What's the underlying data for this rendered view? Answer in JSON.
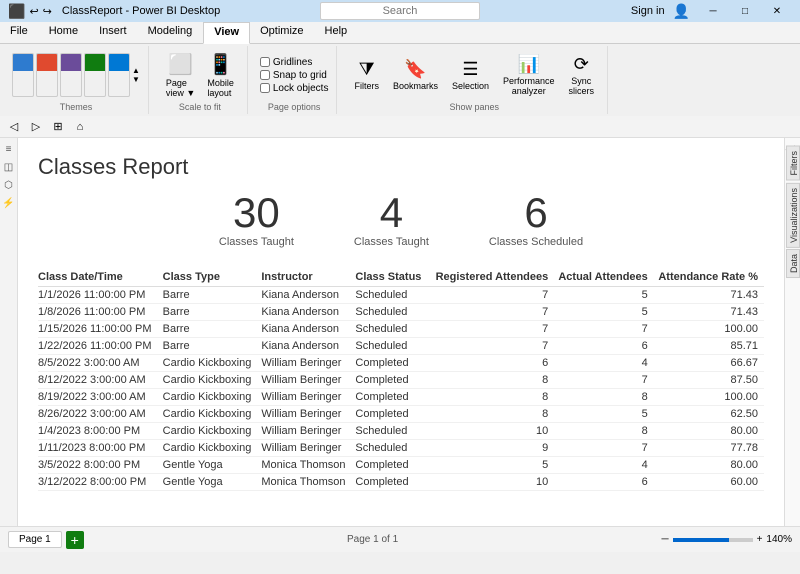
{
  "titlebar": {
    "app_name": "ClassReport - Power BI Desktop",
    "search_placeholder": "Search",
    "signin": "Sign in"
  },
  "ribbon": {
    "tabs": [
      "File",
      "Home",
      "Insert",
      "Modeling",
      "View",
      "Optimize",
      "Help"
    ],
    "active_tab": "View",
    "groups": {
      "themes": {
        "label": "Themes",
        "swatches": [
          "swatch-a",
          "swatch-b",
          "swatch-c",
          "swatch-d",
          "swatch-e"
        ]
      },
      "scale": {
        "label": "Scale to fit",
        "page_view": "Page\nview",
        "mobile_layout": "Mobile\nlayout"
      },
      "page_options": {
        "label": "Page options",
        "gridlines": "Gridlines",
        "snap_to_grid": "Snap to grid",
        "lock_objects": "Lock objects"
      },
      "filters": {
        "label": "Filters"
      },
      "bookmarks": {
        "label": "Bookmarks"
      },
      "selection": {
        "label": "Selection"
      },
      "performance": {
        "label": "Performance\nanalyzer"
      },
      "sync_slicers": {
        "label": "Sync\nslicers"
      },
      "show_panes": "Show panes"
    }
  },
  "left_sidebar": {
    "icons": [
      "≡",
      "◫",
      "⚡",
      "📊"
    ]
  },
  "right_panel": {
    "tabs": [
      "Filters",
      "Visualizations",
      "Data"
    ]
  },
  "report": {
    "title": "Classes Report",
    "stats": [
      {
        "number": "30",
        "label": "Classes Taught"
      },
      {
        "number": "4",
        "label": "Classes Taught"
      },
      {
        "number": "6",
        "label": "Classes Scheduled"
      }
    ],
    "table": {
      "headers": [
        "Class Date/Time",
        "Class Type",
        "Instructor",
        "Class Status",
        "Registered Attendees",
        "Actual Attendees",
        "Attendance Rate %"
      ],
      "rows": [
        [
          "1/1/2026 11:00:00 PM",
          "Barre",
          "Kiana Anderson",
          "Scheduled",
          "7",
          "5",
          "71.43"
        ],
        [
          "1/8/2026 11:00:00 PM",
          "Barre",
          "Kiana Anderson",
          "Scheduled",
          "7",
          "5",
          "71.43"
        ],
        [
          "1/15/2026 11:00:00 PM",
          "Barre",
          "Kiana Anderson",
          "Scheduled",
          "7",
          "7",
          "100.00"
        ],
        [
          "1/22/2026 11:00:00 PM",
          "Barre",
          "Kiana Anderson",
          "Scheduled",
          "7",
          "6",
          "85.71"
        ],
        [
          "8/5/2022 3:00:00 AM",
          "Cardio Kickboxing",
          "William Beringer",
          "Completed",
          "6",
          "4",
          "66.67"
        ],
        [
          "8/12/2022 3:00:00 AM",
          "Cardio Kickboxing",
          "William Beringer",
          "Completed",
          "8",
          "7",
          "87.50"
        ],
        [
          "8/19/2022 3:00:00 AM",
          "Cardio Kickboxing",
          "William Beringer",
          "Completed",
          "8",
          "8",
          "100.00"
        ],
        [
          "8/26/2022 3:00:00 AM",
          "Cardio Kickboxing",
          "William Beringer",
          "Completed",
          "8",
          "5",
          "62.50"
        ],
        [
          "1/4/2023 8:00:00 PM",
          "Cardio Kickboxing",
          "William Beringer",
          "Scheduled",
          "10",
          "8",
          "80.00"
        ],
        [
          "1/11/2023 8:00:00 PM",
          "Cardio Kickboxing",
          "William Beringer",
          "Scheduled",
          "9",
          "7",
          "77.78"
        ],
        [
          "3/5/2022 8:00:00 PM",
          "Gentle Yoga",
          "Monica Thomson",
          "Completed",
          "5",
          "4",
          "80.00"
        ],
        [
          "3/12/2022 8:00:00 PM",
          "Gentle Yoga",
          "Monica Thomson",
          "Completed",
          "10",
          "6",
          "60.00"
        ]
      ]
    }
  },
  "bottom": {
    "page_info": "Page 1 of 1",
    "page_tab": "Page 1",
    "zoom": "140%"
  }
}
